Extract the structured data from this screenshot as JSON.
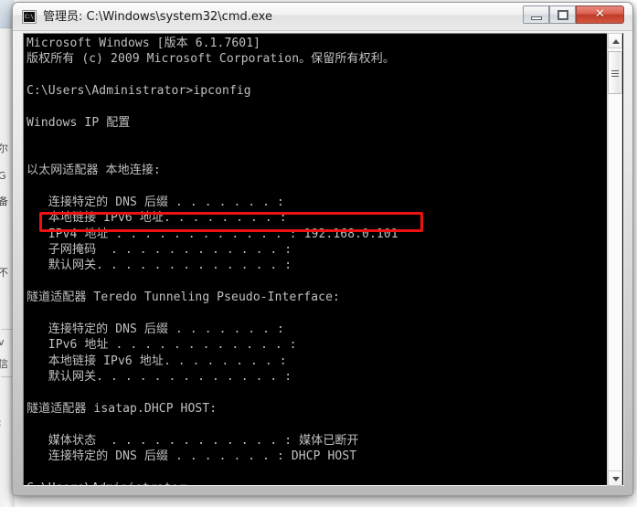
{
  "window": {
    "title": "管理员: C:\\Windows\\system32\\cmd.exe",
    "icon_label": "C:\\",
    "icon_name": "cmd-icon",
    "controls": {
      "minimize_label": "—",
      "maximize_label": "□",
      "close_label": "✕",
      "close_color": "#c03a28"
    }
  },
  "console": {
    "background_color": "#000000",
    "text_color": "#c0c0c0",
    "lines": [
      "Microsoft Windows [版本 6.1.7601]",
      "版权所有 (c) 2009 Microsoft Corporation。保留所有权利。",
      "",
      "C:\\Users\\Administrator>ipconfig",
      "",
      "Windows IP 配置",
      "",
      "",
      "以太网适配器 本地连接:",
      "",
      "   连接特定的 DNS 后缀 . . . . . . . :",
      "   本地链接 IPv6 地址. . . . . . . . :",
      "   IPv4 地址 . . . . . . . . . . . . : 192.168.0.101",
      "   子网掩码  . . . . . . . . . . . . :",
      "   默认网关. . . . . . . . . . . . . :",
      "",
      "隧道适配器 Teredo Tunneling Pseudo-Interface:",
      "",
      "   连接特定的 DNS 后缀 . . . . . . . :",
      "   IPv6 地址 . . . . . . . . . . . . :",
      "   本地链接 IPv6 地址. . . . . . . . :",
      "   默认网关. . . . . . . . . . . . . :",
      "",
      "隧道适配器 isatap.DHCP HOST:",
      "",
      "   媒体状态  . . . . . . . . . . . . : 媒体已断开",
      "   连接特定的 DNS 后缀 . . . . . . . : DHCP HOST",
      "",
      "C:\\Users\\Administrator>"
    ],
    "highlight": {
      "label": "ipv4-address-highlight",
      "color": "#ee1111",
      "value": "192.168.0.101"
    }
  },
  "scrollbar": {
    "up_arrow": "scroll-up-arrow",
    "down_arrow": "scroll-down-arrow",
    "thumb": "scroll-thumb"
  },
  "background_window": {
    "fragments": [
      "尔",
      "G",
      "备",
      "不",
      "v",
      "信",
      ":"
    ]
  }
}
